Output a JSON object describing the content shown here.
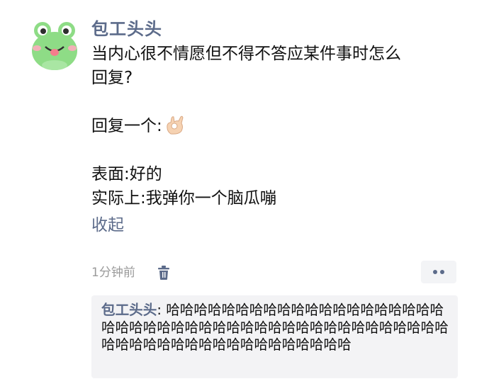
{
  "post": {
    "author": "包工头头",
    "lines": [
      "当内心很不情愿但不得不答应某件事时怎么",
      "回复?",
      "",
      "回复一个:",
      "",
      "表面:好的",
      "实际上:我弹你一个脑瓜嘣"
    ],
    "collapse_label": "收起"
  },
  "meta": {
    "time": "1分钟前"
  },
  "comment": {
    "author": "包工头头",
    "separator": ": ",
    "text": "哈哈哈哈哈哈哈哈哈哈哈哈哈哈哈哈哈哈哈哈哈哈哈哈哈哈哈哈哈哈哈哈哈哈哈哈哈哈哈哈哈哈哈哈哈哈哈哈哈哈哈哈哈哈哈哈哈哈哈哈哈哈哈"
  },
  "icons": {
    "avatar": "frog-avatar",
    "ok_emoji": "ok-hand-emoji",
    "trash": "trash-icon",
    "more": "more-dots-icon"
  },
  "colors": {
    "link": "#5c6b8a",
    "avatar_green": "#7ed67a",
    "comment_bg": "#f3f3f5"
  }
}
